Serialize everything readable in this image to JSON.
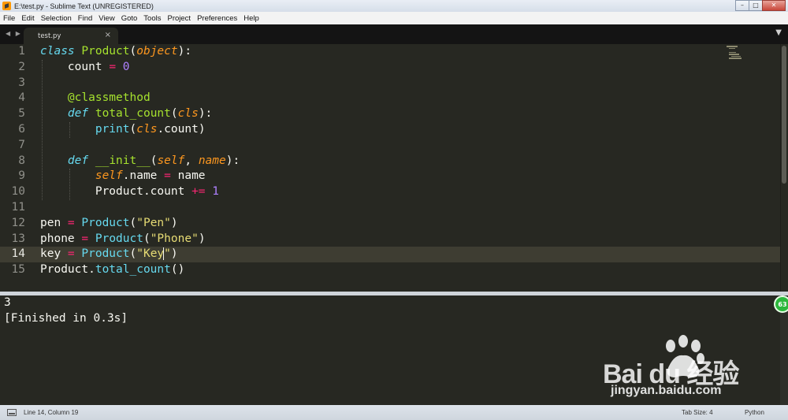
{
  "window": {
    "title": "E:\\test.py - Sublime Text (UNREGISTERED)",
    "controls": {
      "minimize": "–",
      "maximize": "□",
      "close": "✕"
    }
  },
  "menu": [
    "File",
    "Edit",
    "Selection",
    "Find",
    "View",
    "Goto",
    "Tools",
    "Project",
    "Preferences",
    "Help"
  ],
  "tabs": {
    "nav": "◀ ▶",
    "active": {
      "label": "test.py",
      "close": "×"
    },
    "dropdown": "▼"
  },
  "editor": {
    "active_line": 14,
    "line_numbers": [
      "1",
      "2",
      "3",
      "4",
      "5",
      "6",
      "7",
      "8",
      "9",
      "10",
      "11",
      "12",
      "13",
      "14",
      "15"
    ],
    "lines": [
      [
        [
          "k",
          "class"
        ],
        [
          "t",
          " "
        ],
        [
          "n",
          "Product"
        ],
        [
          "t",
          "("
        ],
        [
          "p",
          "object"
        ],
        [
          "t",
          "):"
        ]
      ],
      [
        [
          "t",
          "    count "
        ],
        [
          "o",
          "="
        ],
        [
          "t",
          " "
        ],
        [
          "c",
          "0"
        ]
      ],
      [],
      [
        [
          "t",
          "    "
        ],
        [
          "n",
          "@classmethod"
        ]
      ],
      [
        [
          "t",
          "    "
        ],
        [
          "k",
          "def"
        ],
        [
          "t",
          " "
        ],
        [
          "n",
          "total_count"
        ],
        [
          "t",
          "("
        ],
        [
          "p",
          "cls"
        ],
        [
          "t",
          "):"
        ]
      ],
      [
        [
          "t",
          "        "
        ],
        [
          "b",
          "print"
        ],
        [
          "t",
          "("
        ],
        [
          "p",
          "cls"
        ],
        [
          "t",
          ".count)"
        ]
      ],
      [],
      [
        [
          "t",
          "    "
        ],
        [
          "k",
          "def"
        ],
        [
          "t",
          " "
        ],
        [
          "n",
          "__init__"
        ],
        [
          "t",
          "("
        ],
        [
          "p",
          "self"
        ],
        [
          "t",
          ", "
        ],
        [
          "p",
          "name"
        ],
        [
          "t",
          "):"
        ]
      ],
      [
        [
          "t",
          "        "
        ],
        [
          "p",
          "self"
        ],
        [
          "t",
          ".name "
        ],
        [
          "o",
          "="
        ],
        [
          "t",
          " name"
        ]
      ],
      [
        [
          "t",
          "        Product.count "
        ],
        [
          "o",
          "+="
        ],
        [
          "t",
          " "
        ],
        [
          "c",
          "1"
        ]
      ],
      [],
      [
        [
          "t",
          "pen "
        ],
        [
          "o",
          "="
        ],
        [
          "t",
          " "
        ],
        [
          "b",
          "Product"
        ],
        [
          "t",
          "("
        ],
        [
          "s",
          "\"Pen\""
        ],
        [
          "t",
          ")"
        ]
      ],
      [
        [
          "t",
          "phone "
        ],
        [
          "o",
          "="
        ],
        [
          "t",
          " "
        ],
        [
          "b",
          "Product"
        ],
        [
          "t",
          "("
        ],
        [
          "s",
          "\"Phone\""
        ],
        [
          "t",
          ")"
        ]
      ],
      [
        [
          "t",
          "key "
        ],
        [
          "o",
          "="
        ],
        [
          "t",
          " "
        ],
        [
          "b",
          "Product"
        ],
        [
          "t",
          "("
        ],
        [
          "s",
          "\"Key"
        ],
        [
          "cursor",
          ""
        ],
        [
          "s",
          "\""
        ],
        [
          "t",
          ")"
        ]
      ],
      [
        [
          "t",
          "Product."
        ],
        [
          "b",
          "total_count"
        ],
        [
          "t",
          "()"
        ]
      ]
    ]
  },
  "output": {
    "lines": [
      "3",
      "[Finished in 0.3s]"
    ],
    "badge": "63"
  },
  "watermark": {
    "brand": "Bai du 经验",
    "site": "jingyan.baidu.com"
  },
  "status": {
    "position": "Line 14, Column 19",
    "tab_size": "Tab Size: 4",
    "syntax": "Python"
  },
  "colors": {
    "editor_bg": "#272822",
    "keyword": "#66d9ef",
    "name": "#a6e22e",
    "param": "#fd971f",
    "operator": "#f92672",
    "number": "#ae81ff",
    "string": "#e6db74"
  }
}
